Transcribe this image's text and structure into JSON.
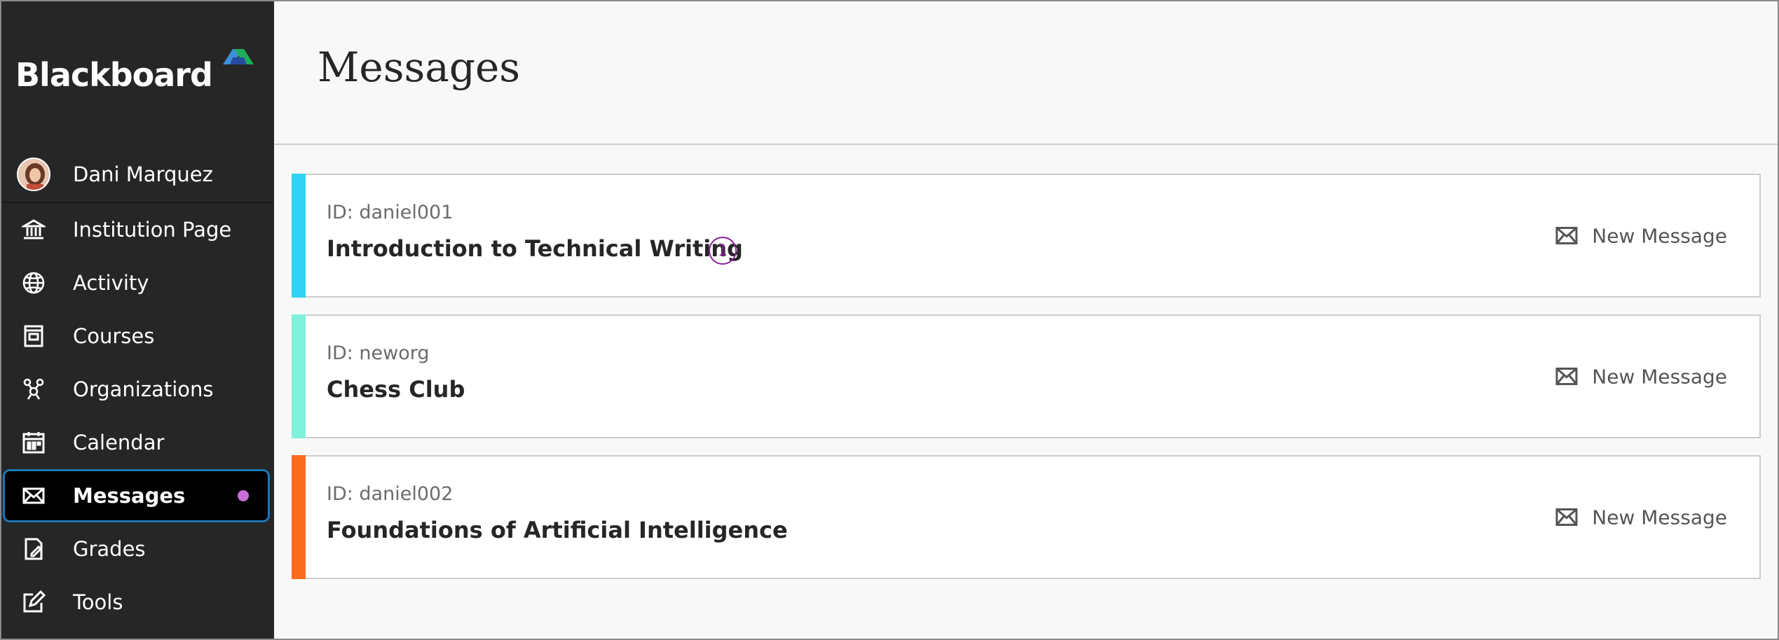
{
  "brand": {
    "logo_text": "Blackboard"
  },
  "sidebar": {
    "profile_name": "Dani Marquez",
    "items": [
      {
        "label": "Institution Page",
        "icon": "institution-icon"
      },
      {
        "label": "Activity",
        "icon": "globe-icon"
      },
      {
        "label": "Courses",
        "icon": "courses-icon"
      },
      {
        "label": "Organizations",
        "icon": "organizations-icon"
      },
      {
        "label": "Calendar",
        "icon": "calendar-icon"
      },
      {
        "label": "Messages",
        "icon": "envelope-icon",
        "active": true,
        "unread": true
      },
      {
        "label": "Grades",
        "icon": "grades-icon"
      },
      {
        "label": "Tools",
        "icon": "tools-icon"
      }
    ],
    "active_color": "#1f77b4",
    "unread_dot_color": "#c86dd7"
  },
  "header": {
    "title": "Messages"
  },
  "courses": [
    {
      "id": "ID: daniel001",
      "name": "Introduction to Technical Writing",
      "unread_count": "1",
      "accent": "#2fd2f0",
      "action": "New Message"
    },
    {
      "id": "ID: neworg",
      "name": "Chess Club",
      "accent": "#7ff0d9",
      "action": "New Message"
    },
    {
      "id": "ID: daniel002",
      "name": "Foundations of Artificial Intelligence",
      "accent": "#fa6b1e",
      "action": "New Message"
    }
  ]
}
